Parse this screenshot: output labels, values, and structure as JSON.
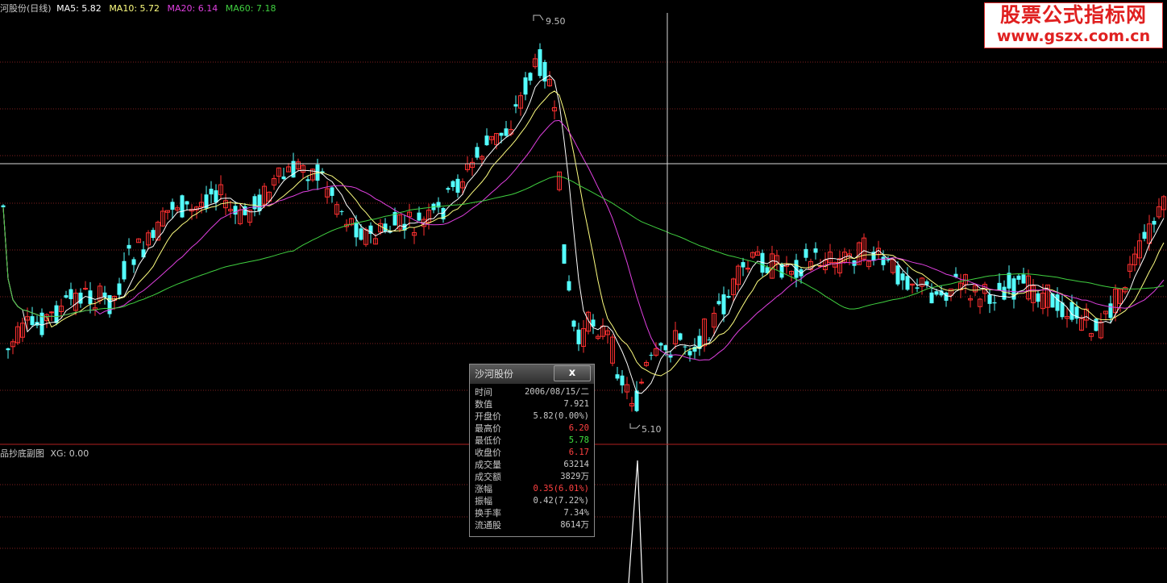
{
  "main_header": {
    "title": "河股份(日线)",
    "ma5_label": "MA5: 5.82",
    "ma10_label": "MA10: 5.72",
    "ma20_label": "MA20: 6.14",
    "ma60_label": "MA60: 7.18"
  },
  "sub_header": {
    "title": "品抄底副图",
    "xg_label": "XG: 0.00"
  },
  "annotations": {
    "high_label": "9.50",
    "low_label": "5.10"
  },
  "watermark": {
    "line1": "股票公式指标网",
    "line2": "www.gszx.com.cn"
  },
  "colors": {
    "up": "#ff3030",
    "down": "#54ffff",
    "ma5": "#ffffff",
    "ma10": "#ffff80",
    "ma20": "#e040e0",
    "ma60": "#40d040",
    "grid": "#802020"
  },
  "tooltip": {
    "title": "沙河股份",
    "close_label": "x",
    "rows": [
      {
        "label": "时间",
        "value": "2006/08/15/二",
        "color": ""
      },
      {
        "label": "数值",
        "value": "7.921",
        "color": ""
      },
      {
        "label": "开盘价",
        "value": "5.82(0.00%)",
        "color": ""
      },
      {
        "label": "最高价",
        "value": "6.20",
        "color": "red"
      },
      {
        "label": "最低价",
        "value": "5.78",
        "color": "green"
      },
      {
        "label": "收盘价",
        "value": "6.17",
        "color": "red"
      },
      {
        "label": "成交量",
        "value": "63214",
        "color": ""
      },
      {
        "label": "成交额",
        "value": "3829万",
        "color": ""
      },
      {
        "label": "涨幅",
        "value": "0.35(6.01%)",
        "color": "red"
      },
      {
        "label": "振幅",
        "value": "0.42(7.22%)",
        "color": ""
      },
      {
        "label": "换手率",
        "value": "7.34%",
        "color": ""
      },
      {
        "label": "流通股",
        "value": "8614万",
        "color": ""
      }
    ]
  }
}
